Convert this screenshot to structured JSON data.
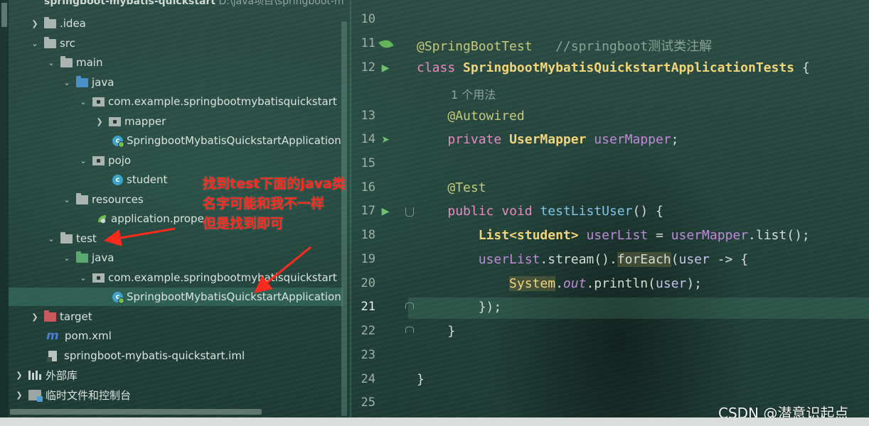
{
  "window": {
    "title_visible": "springboot-mybatis-quickstart",
    "title_path": "D:\\java项目\\springboot-m"
  },
  "tree": {
    "items": [
      {
        "label": ".idea",
        "icon": "folder-icon"
      },
      {
        "label": "src",
        "icon": "folder-icon"
      },
      {
        "label": "main",
        "icon": "folder-icon"
      },
      {
        "label": "java",
        "icon": "source-folder-icon"
      },
      {
        "label": "com.example.springbootmybatisquickstart",
        "icon": "package-icon"
      },
      {
        "label": "mapper",
        "icon": "package-icon"
      },
      {
        "label": "SpringbootMybatisQuickstartApplication",
        "icon": "spring-class-icon"
      },
      {
        "label": "pojo",
        "icon": "package-icon"
      },
      {
        "label": "student",
        "icon": "class-icon"
      },
      {
        "label": "resources",
        "icon": "resources-folder-icon"
      },
      {
        "label": "application.prope",
        "icon": "spring-properties-icon"
      },
      {
        "label": "test",
        "icon": "folder-icon"
      },
      {
        "label": "java",
        "icon": "test-source-folder-icon"
      },
      {
        "label": "com.example.springbootmybatisquickstart",
        "icon": "package-icon"
      },
      {
        "label": "SpringbootMybatisQuickstartApplication",
        "icon": "spring-class-icon"
      },
      {
        "label": "target",
        "icon": "excluded-folder-icon"
      },
      {
        "label": "pom.xml",
        "icon": "maven-icon"
      },
      {
        "label": "springboot-mybatis-quickstart.iml",
        "icon": "iml-file-icon"
      },
      {
        "label": "外部库",
        "icon": "library-icon"
      },
      {
        "label": "临时文件和控制台",
        "icon": "scratch-icon"
      }
    ]
  },
  "annotation": {
    "lines": [
      "找到test下面的java类",
      "名字可能和我不一样",
      "但是找到即可"
    ],
    "color": "#ff2a1e"
  },
  "editor": {
    "line_numbers": [
      "10",
      "11",
      "12",
      "13",
      "14",
      "15",
      "16",
      "17",
      "18",
      "19",
      "20",
      "21",
      "22",
      "23",
      "24",
      "25"
    ],
    "current_line": "21",
    "usage_hint": "1 个用法",
    "tokens": {
      "l11_ann": "@SpringBootTest",
      "l11_comment": "//springboot测试类注解",
      "l12_kw": "class",
      "l12_cls": "SpringbootMybatisQuickstartApplicationTests",
      "l12_brace": " {",
      "l13_ann": "@Autowired",
      "l14_kw": "private",
      "l14_type": "UserMapper",
      "l14_field": "userMapper",
      "l14_semi": ";",
      "l16_ann": "@Test",
      "l17_kw1": "public",
      "l17_kw2": "void",
      "l17_method": "testListUser",
      "l17_rest": "() {",
      "l18_type": "List",
      "l18_generic": "<student>",
      "l18_var": "userList",
      "l18_eq": " = ",
      "l18_field": "userMapper",
      "l18_call": ".list();",
      "l19_var": "userList",
      "l19_stream": ".stream().",
      "l19_foreach": "forEach",
      "l19_open": "(",
      "l19_param": "user",
      "l19_arrow": " -> {",
      "l20_sys": "System",
      "l20_dot": ".",
      "l20_out": "out",
      "l20_call": ".println(",
      "l20_arg": "user",
      "l20_end": ");",
      "l21": "});",
      "l22": "}",
      "l24": "}"
    }
  },
  "watermark": "CSDN @潜意识起点"
}
